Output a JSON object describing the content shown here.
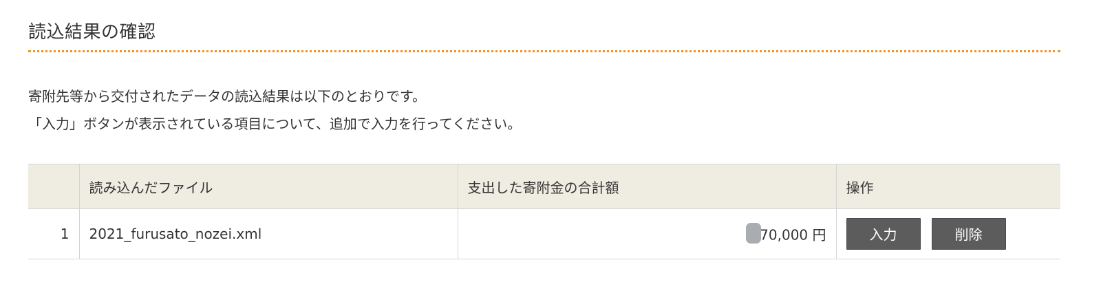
{
  "page": {
    "title": "読込結果の確認",
    "description_lines": [
      "寄附先等から交付されたデータの読込結果は以下のとおりです。",
      "「入力」ボタンが表示されている項目について、追加で入力を行ってください。"
    ]
  },
  "table": {
    "headers": [
      "",
      "読み込んだファイル",
      "支出した寄附金の合計額",
      "操作"
    ],
    "rows": [
      {
        "num": "1",
        "file": "2021_furusato_nozei.xml",
        "amount": "70,000 円",
        "input_label": "入力",
        "delete_label": "削除"
      }
    ]
  },
  "colors": {
    "accent_rule": "#f0921c",
    "header_bg": "#efede2",
    "button_bg": "#5c5c5c",
    "mask": "#a9adb1"
  }
}
